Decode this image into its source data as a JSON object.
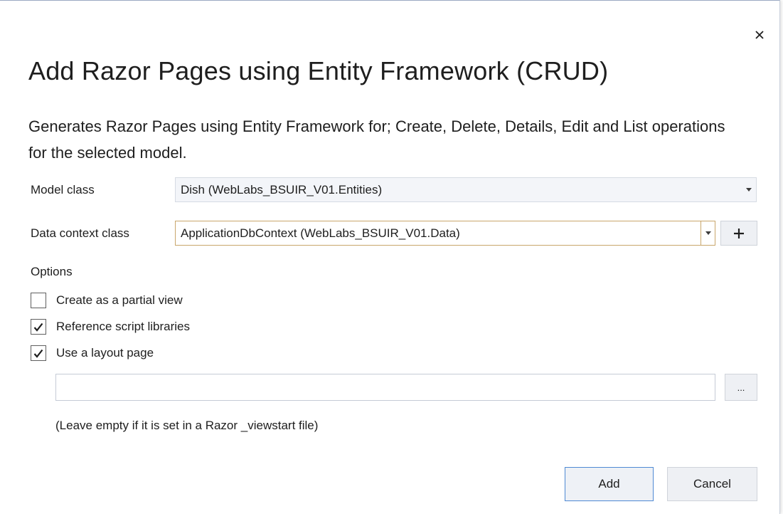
{
  "dialog": {
    "title": "Add Razor Pages using Entity Framework (CRUD)",
    "description": "Generates Razor Pages using Entity Framework for; Create, Delete, Details, Edit and List operations for the selected model.",
    "close_icon": "close-icon"
  },
  "model_class": {
    "label": "Model class",
    "value": "Dish (WebLabs_BSUIR_V01.Entities)"
  },
  "data_context_class": {
    "label": "Data context class",
    "value": "ApplicationDbContext (WebLabs_BSUIR_V01.Data)",
    "add_icon": "plus-icon"
  },
  "options": {
    "heading": "Options",
    "items": [
      {
        "label": "Create as a partial view",
        "checked": false
      },
      {
        "label": "Reference script libraries",
        "checked": true
      },
      {
        "label": "Use a layout page",
        "checked": true
      }
    ]
  },
  "layout_page": {
    "value": "",
    "placeholder": "",
    "browse_label": "...",
    "hint": "(Leave empty if it is set in a Razor _viewstart file)"
  },
  "buttons": {
    "add": "Add",
    "cancel": "Cancel"
  },
  "colors": {
    "accent_border": "#4f8ad4",
    "focus_border": "#c9a66b"
  }
}
